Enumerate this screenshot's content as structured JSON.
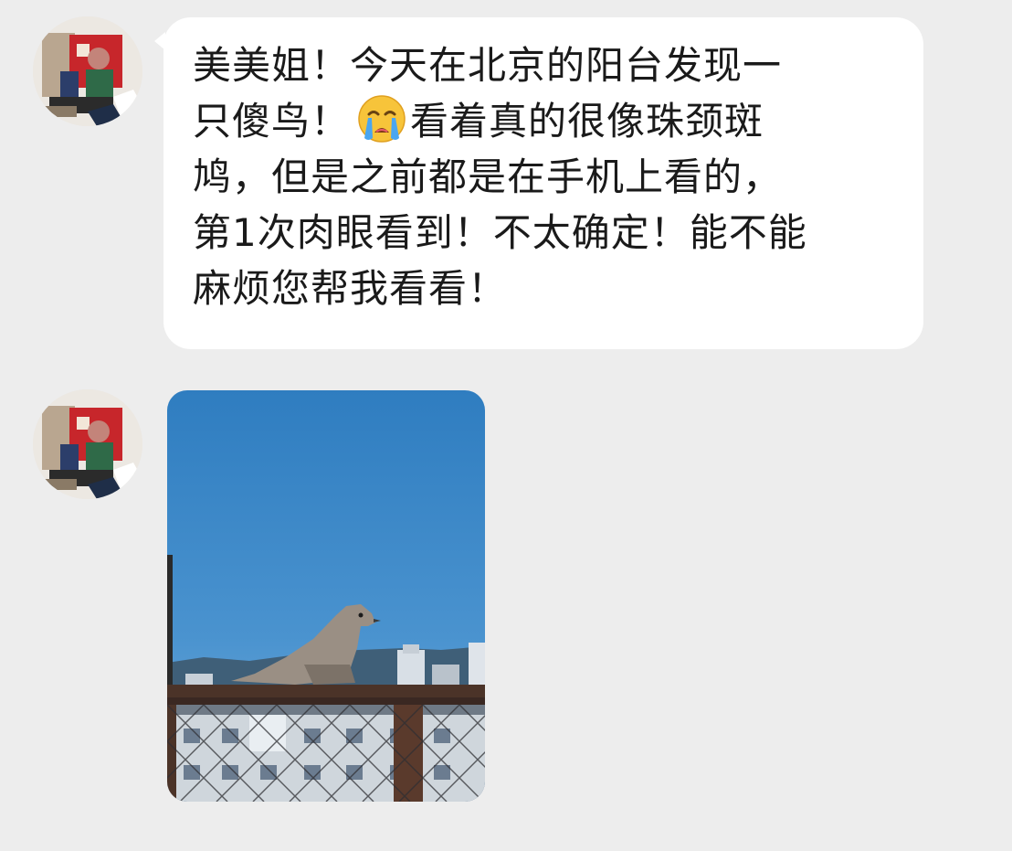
{
  "messages": [
    {
      "type": "text",
      "lines": [
        "美美姐！今天在北京的阳台发现一",
        "只傻鸟！",
        "看着真的很像珠颈斑",
        "鸠，但是之前都是在手机上看的，",
        "第1次肉眼看到！不太确定！能不能",
        "麻烦您帮我看看！"
      ],
      "emoji": "crying-face-icon"
    },
    {
      "type": "image",
      "content": "dove-photo"
    }
  ],
  "colors": {
    "background": "#ededed",
    "bubble": "#ffffff",
    "text": "#1a1a1a",
    "sky": "#3d86c6"
  }
}
